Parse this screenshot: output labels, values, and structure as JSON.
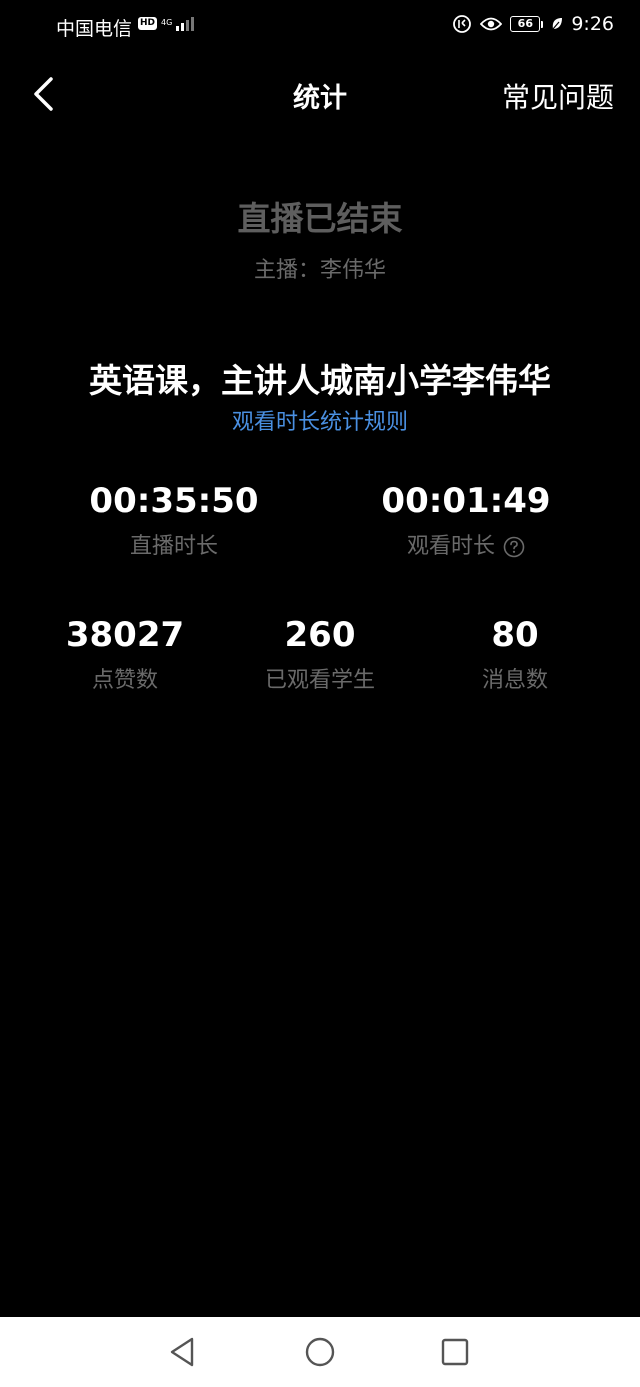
{
  "status_bar": {
    "carrier": "中国电信",
    "hd_badge": "HD",
    "network": "4G",
    "battery": "66",
    "time": "9:26"
  },
  "nav": {
    "title": "统计",
    "faq": "常见问题"
  },
  "live": {
    "ended": "直播已结束",
    "host": "主播：李伟华"
  },
  "course": {
    "title": "英语课，主讲人城南小学李伟华",
    "rules_link": "观看时长统计规则"
  },
  "stats": {
    "live_duration": {
      "value": "00:35:50",
      "label": "直播时长"
    },
    "watch_duration": {
      "value": "00:01:49",
      "label": "观看时长"
    },
    "likes": {
      "value": "38027",
      "label": "点赞数"
    },
    "viewers": {
      "value": "260",
      "label": "已观看学生"
    },
    "messages": {
      "value": "80",
      "label": "消息数"
    }
  },
  "colors": {
    "background": "#000000",
    "link": "#4a90e2",
    "muted": "#6a6a6a"
  }
}
